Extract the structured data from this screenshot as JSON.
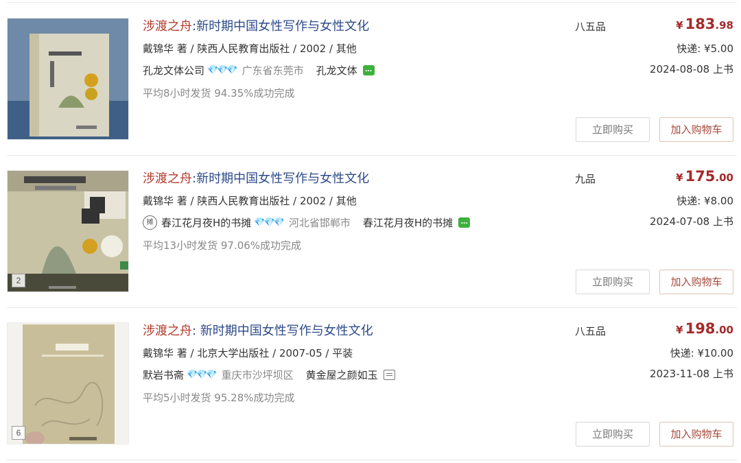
{
  "listings": [
    {
      "title_highlight": "涉渡之舟",
      "title_rest": ":新时期中国女性写作与女性文化",
      "meta": "戴锦华 著 / 陕西人民教育出版社 / 2002 / 其他",
      "shop_badge": "",
      "shop_name": "孔龙文体公司",
      "region": "广东省东莞市",
      "seller": "孔龙文体",
      "chat_icon": "chat-green-icon",
      "stats": "平均8小时发货  94.35%成功完成",
      "quality": "八五品",
      "price_symbol": "¥",
      "price_int": "183",
      "price_dec": ".98",
      "shipping": "快递: ¥5.00",
      "listed_date": "2024-08-08 上书",
      "buy_now_label": "立即购买",
      "add_cart_label": "加入购物车",
      "image_count": ""
    },
    {
      "title_highlight": "涉渡之舟",
      "title_rest": ":新时期中国女性写作与女性文化",
      "meta": "戴锦华 著 / 陕西人民教育出版社 / 2002 / 其他",
      "shop_badge": "摊",
      "shop_name": "春江花月夜H的书摊",
      "region": "河北省邯郸市",
      "seller": "春江花月夜H的书摊",
      "chat_icon": "chat-green-icon",
      "stats": "平均13小时发货  97.06%成功完成",
      "quality": "九品",
      "price_symbol": "¥",
      "price_int": "175",
      "price_dec": ".00",
      "shipping": "快递: ¥8.00",
      "listed_date": "2024-07-08 上书",
      "buy_now_label": "立即购买",
      "add_cart_label": "加入购物车",
      "image_count": "2"
    },
    {
      "title_highlight": "涉渡之舟",
      "title_rest": ": 新时期中国女性写作与女性文化",
      "meta": "戴锦华 著 / 北京大学出版社 / 2007-05 / 平装",
      "shop_badge": "",
      "shop_name": "默岩书斋",
      "region": "重庆市沙坪坝区",
      "seller": "黄金屋之颜如玉",
      "chat_icon": "chat-outline-icon",
      "stats": "平均5小时发货  95.28%成功完成",
      "quality": "八五品",
      "price_symbol": "¥",
      "price_int": "198",
      "price_dec": ".00",
      "shipping": "快递: ¥10.00",
      "listed_date": "2023-11-08 上书",
      "buy_now_label": "立即购买",
      "add_cart_label": "加入购物车",
      "image_count": "6"
    }
  ],
  "diamond_glyphs": "💎💎💎",
  "colors": {
    "title_highlight": "#b33a2e",
    "title_link": "#2d4a8a",
    "price": "#a52a2a",
    "diamond": "#5aaee8",
    "chat": "#3db13d"
  }
}
